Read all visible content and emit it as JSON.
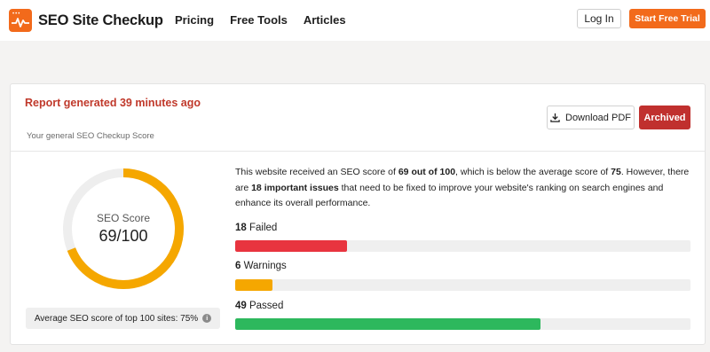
{
  "header": {
    "logo_text": "SEO Site Checkup",
    "nav": [
      "Pricing",
      "Free Tools",
      "Articles"
    ],
    "login_label": "Log In",
    "trial_label": "Start Free Trial"
  },
  "report": {
    "generated_text": "Report generated 39 minutes ago",
    "subtitle": "Your general SEO Checkup Score",
    "download_label": "Download PDF",
    "archived_label": "Archived"
  },
  "score": {
    "label": "SEO Score",
    "value_text": "69/100",
    "value": 69,
    "max": 100,
    "average_text": "Average SEO score of top 100 sites: 75%"
  },
  "summary": {
    "part1": "This website received an SEO score of ",
    "score_bold": "69 out of 100",
    "part2": ", which is below the average score of ",
    "avg_bold": "75",
    "part3": ". However, there are ",
    "issues_bold": "18 important issues",
    "part4": " that need to be fixed to improve your website's ranking on search engines and enhance its overall performance."
  },
  "metrics": [
    {
      "count": "18",
      "label": " Failed",
      "fraction": 0.246,
      "color": "#e8343f"
    },
    {
      "count": "6",
      "label": " Warnings",
      "fraction": 0.082,
      "color": "#f5a700"
    },
    {
      "count": "49",
      "label": " Passed",
      "fraction": 0.671,
      "color": "#2db85d"
    }
  ],
  "colors": {
    "brand": "#f26a1b",
    "archived": "#c0302e",
    "gauge": "#f5a700",
    "gauge_track": "#eeeeee"
  },
  "icons": {
    "logo": "pulse-icon",
    "download": "download-icon",
    "info": "info-icon"
  }
}
